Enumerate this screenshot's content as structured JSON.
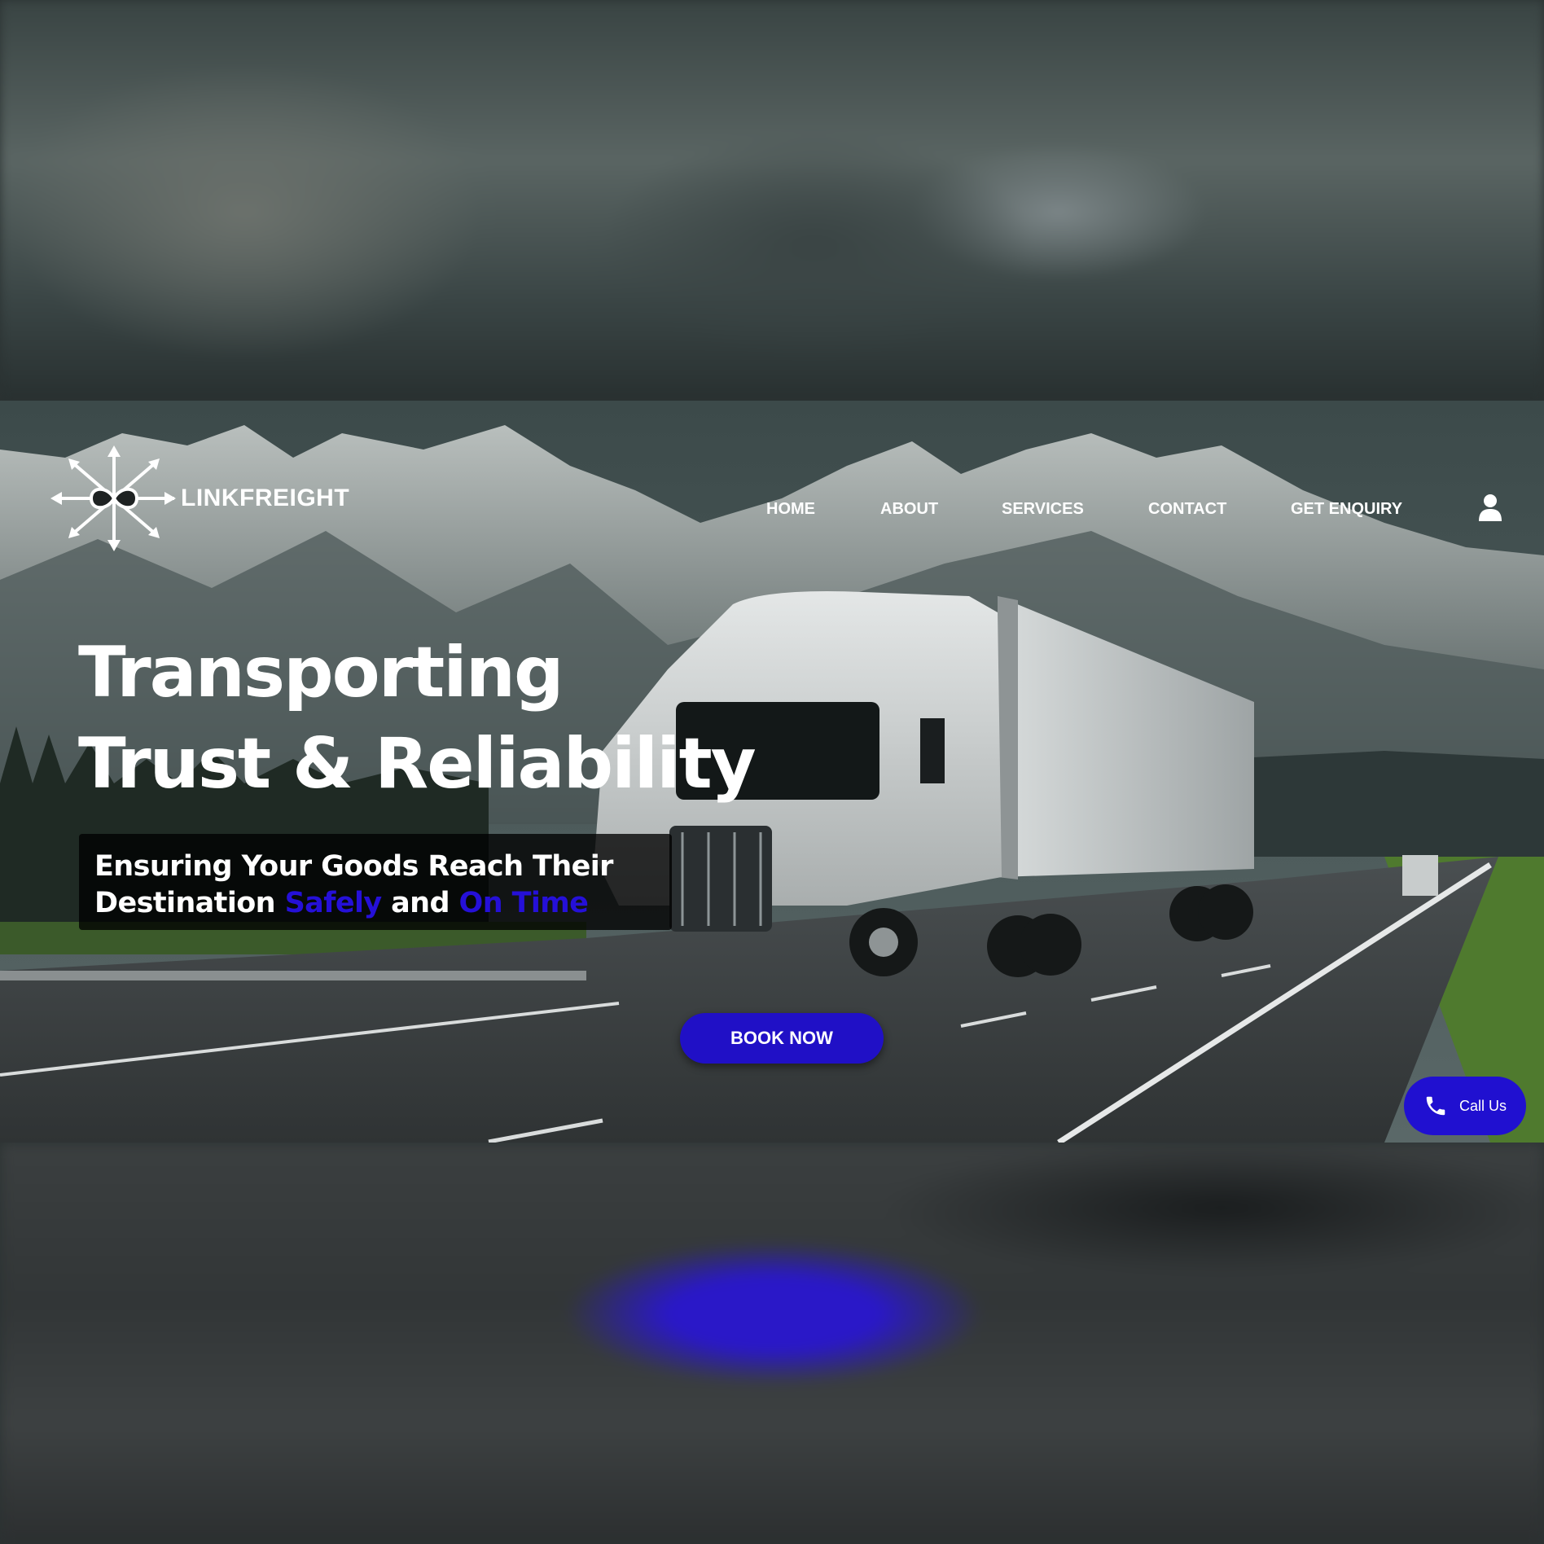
{
  "brand": {
    "name": "LINKFREIGHT",
    "logo_icon": "infinity-arrows-icon"
  },
  "nav": {
    "items": [
      {
        "label": "HOME"
      },
      {
        "label": "ABOUT"
      },
      {
        "label": "SERVICES"
      },
      {
        "label": "CONTACT"
      },
      {
        "label": "GET ENQUIRY"
      }
    ],
    "account_icon": "user-icon"
  },
  "hero": {
    "headline_line1": "Transporting",
    "headline_line2": "Trust & Reliability",
    "sub_part1": "Ensuring Your Goods Reach Their",
    "sub_part2": "Destination ",
    "sub_accent1": "Safely",
    "sub_part3": " and ",
    "sub_accent2": "On Time",
    "cta_label": "BOOK NOW"
  },
  "call": {
    "label": "Call Us",
    "icon": "phone-icon"
  },
  "colors": {
    "accent": "#2510d8",
    "button": "#2010c6",
    "text": "#ffffff"
  }
}
